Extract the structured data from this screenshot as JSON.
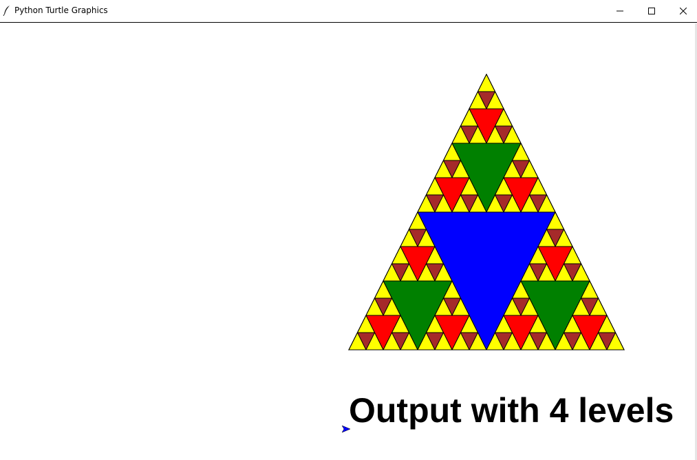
{
  "window": {
    "title": "Python Turtle Graphics",
    "icon": "feather-icon",
    "controls": [
      "minimize-icon",
      "maximize-icon",
      "close-icon"
    ]
  },
  "canvas": {
    "caption": "Output with 4 levels",
    "fractal": {
      "type": "sierpinski-triangle",
      "levels": 4,
      "colors": [
        "#0000FF",
        "#008000",
        "#FF0000",
        "#A52A2A",
        "#FFFF00"
      ],
      "outline": "#000000"
    },
    "turtle": {
      "shape": "arrow-icon",
      "fill": "#0000FF"
    }
  }
}
